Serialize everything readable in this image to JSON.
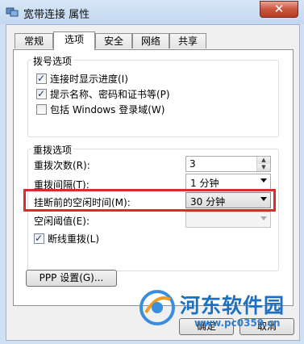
{
  "window": {
    "title": "宽带连接 属性",
    "close_glyph": "✕"
  },
  "tabs": [
    {
      "label": "常规",
      "active": false
    },
    {
      "label": "选项",
      "active": true
    },
    {
      "label": "安全",
      "active": false
    },
    {
      "label": "网络",
      "active": false
    },
    {
      "label": "共享",
      "active": false
    }
  ],
  "dial_options": {
    "title": "拨号选项",
    "items": [
      {
        "label": "连接时显示进度(I)",
        "checked": true
      },
      {
        "label": "提示名称、密码和证书等(P)",
        "checked": true
      },
      {
        "label": "包括 Windows 登录域(W)",
        "checked": false
      }
    ]
  },
  "redial_options": {
    "title": "重拨选项",
    "redial_count": {
      "label": "重拨次数(R):",
      "value": "3"
    },
    "redial_interval": {
      "label": "重拨间隔(T):",
      "value": "1 分钟"
    },
    "idle_time": {
      "label": "挂断前的空闲时间(M):",
      "value": "30 分钟"
    },
    "idle_threshold": {
      "label": "空闲阈值(E):",
      "value": ""
    },
    "reconnect": {
      "label": "断线重拨(L)",
      "checked": true
    }
  },
  "ppp_button": "PPP 设置(G)...",
  "buttons": {
    "ok": "确定",
    "cancel": "取消"
  },
  "watermark": {
    "text": "河东软件园",
    "url": "www.pc0359.cn"
  },
  "colors": {
    "highlight": "#e02a2a",
    "title_bar": "#c3d8f0"
  }
}
